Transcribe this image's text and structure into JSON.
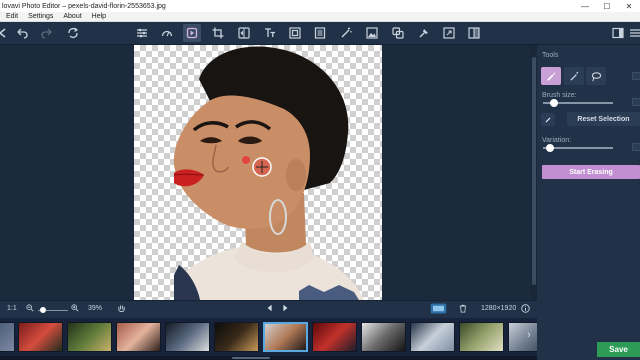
{
  "window": {
    "title": "lovavi Photo Editor – pexels-david-florin-2553653.jpg",
    "minimize": "—",
    "maximize": "☐",
    "close": "✕"
  },
  "menu": [
    "Edit",
    "Settings",
    "About",
    "Help"
  ],
  "toolbar": {
    "icons": [
      "back-icon",
      "undo-icon",
      "redo-icon",
      "reset-icon",
      "adjust-icon",
      "filters-icon",
      "object-removal-icon",
      "crop-icon",
      "flip-icon",
      "text-icon",
      "frames-icon",
      "insert-icon",
      "magic-icon",
      "background-icon",
      "clone-icon",
      "pin-icon",
      "resize-icon",
      "compare-icon",
      "panel-toggle-icon",
      "menu-icon"
    ]
  },
  "panel": {
    "tools_label": "Tools",
    "brush_size_label": "Brush size:",
    "brush_size_level": 0.12,
    "reset_selection": "Reset Selection",
    "variation_label": "Variation:",
    "variation_level": 0.05,
    "start_erasing": "Start Erasing",
    "save": "Save",
    "accent": "#c18ed1",
    "save_color": "#2e9c57"
  },
  "statusbar": {
    "ratio": "1:1",
    "zoom": "39%",
    "dimensions": "1280×1920",
    "zoom_level": 0.1
  },
  "filmstrip": {
    "selected_index": 5
  }
}
